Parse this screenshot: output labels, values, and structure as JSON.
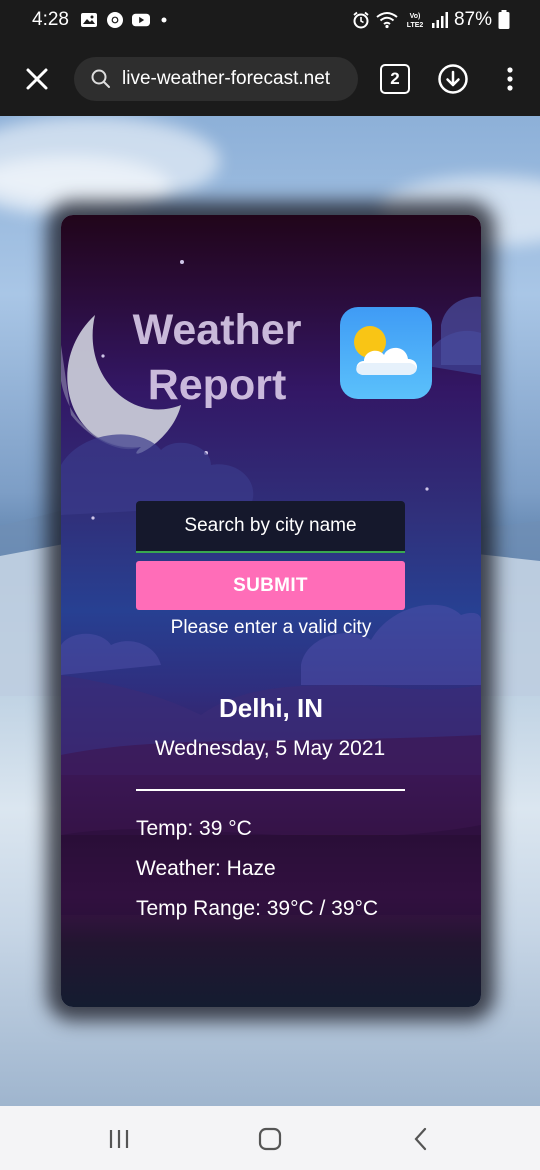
{
  "status_bar": {
    "time": "4:28",
    "battery": "87%",
    "left_icons": [
      "gallery-icon",
      "chrome-icon",
      "youtube-icon",
      "dot-icon"
    ],
    "right_icons": [
      "alarm-icon",
      "wifi-icon",
      "volte-icon",
      "signal-icon",
      "battery-icon"
    ]
  },
  "browser": {
    "url": "live-weather-forecast.net",
    "tab_count": "2"
  },
  "app": {
    "title_line1": "Weather",
    "title_line2": "Report",
    "search_placeholder": "Search by city name",
    "submit_label": "SUBMIT",
    "error_message": "Please enter a valid city",
    "city": "Delhi, IN",
    "date": "Wednesday, 5 May 2021",
    "temp": "Temp: 39 °C",
    "weather": "Weather: Haze",
    "temp_range": "Temp Range: 39°C / 39°C"
  },
  "colors": {
    "submit_bg": "#ff6db8",
    "input_underline": "#39a84f",
    "weather_icon_bg": "#4aa9f8"
  }
}
